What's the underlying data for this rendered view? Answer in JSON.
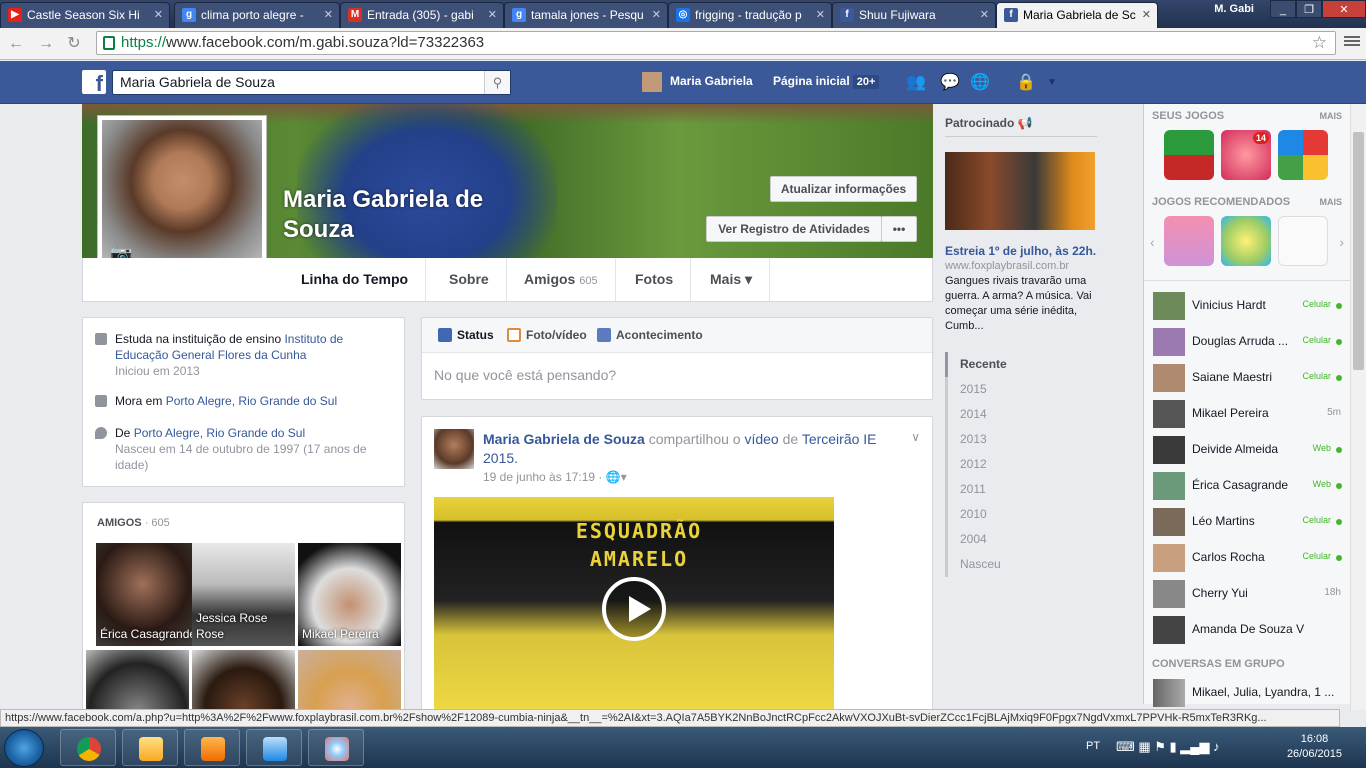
{
  "browser": {
    "tabs": [
      {
        "label": "Castle Season Six Hi",
        "icon": "youtube-icon",
        "color": "#e62117",
        "glyph": "▶"
      },
      {
        "label": "clima porto alegre -",
        "icon": "google-icon",
        "color": "#4285f4",
        "glyph": "g"
      },
      {
        "label": "Entrada (305) - gabi",
        "icon": "gmail-icon",
        "color": "#d93025",
        "glyph": "M"
      },
      {
        "label": "tamala jones - Pesqu",
        "icon": "google-icon",
        "color": "#4285f4",
        "glyph": "g"
      },
      {
        "label": "frigging - tradução p",
        "icon": "translator-icon",
        "color": "#1a73e8",
        "glyph": "◎"
      },
      {
        "label": "Shuu Fujiwara",
        "icon": "facebook-icon",
        "color": "#3b5998",
        "glyph": "f"
      },
      {
        "label": "Maria Gabriela de Sc",
        "icon": "facebook-icon",
        "color": "#3b5998",
        "glyph": "f"
      }
    ],
    "user": "M. Gabi",
    "url_scheme": "https://",
    "url_rest": "www.facebook.com/m.gabi.souza?ld=73322363",
    "status_url": "https://www.facebook.com/a.php?u=http%3A%2F%2Fwww.foxplaybrasil.com.br%2Fshow%2F12089-cumbia-ninja&__tn__=%2AI&xt=3.AQIa7A5BYK2NnBoJnctRCpFcc2AkwVXOJXuBt-svDierZCcc1FcjBLAjMxiq9F0Fpgx7NgdVxmxL7PPVHk-R5mxTeR3RKg..."
  },
  "fb": {
    "search_value": "Maria Gabriela de Souza",
    "nav_name": "Maria Gabriela",
    "home_label": "Página inicial",
    "home_badge": "20+"
  },
  "profile": {
    "name": "Maria Gabriela de Souza",
    "update_info": "Atualizar informações",
    "activity_log": "Ver Registro de Atividades",
    "more_dots": "•••",
    "tabs": [
      {
        "label": "Linha do Tempo"
      },
      {
        "label": "Sobre"
      },
      {
        "label": "Amigos",
        "count": "605"
      },
      {
        "label": "Fotos"
      },
      {
        "label": "Mais ▾"
      }
    ]
  },
  "intro": {
    "study_prefix": "Estuda na instituição de ensino",
    "study_link": "Instituto de Educação General Flores da Cunha",
    "study_since": "Iniciou em 2013",
    "lives_prefix": "Mora em",
    "lives_link": "Porto Alegre, Rio Grande do Sul",
    "from_prefix": "De",
    "from_link": "Porto Alegre, Rio Grande do Sul",
    "born": "Nasceu em 14 de outubro de 1997 (17 anos de idade)"
  },
  "friends": {
    "title": "AMIGOS",
    "count": "· 605",
    "items": [
      {
        "name": "Érica Casagrande"
      },
      {
        "name": "Jessica Rose Rose"
      },
      {
        "name": "Mikael Pereira"
      },
      {
        "name": ""
      },
      {
        "name": ""
      },
      {
        "name": ""
      }
    ]
  },
  "composer": {
    "status": "Status",
    "photo": "Foto/vídeo",
    "event": "Acontecimento",
    "placeholder": "No que você está pensando?"
  },
  "post": {
    "author": "Maria Gabriela de Souza",
    "shared": "compartilhou o",
    "video_word": "vídeo",
    "of": "de",
    "source": "Terceirão IE 2015.",
    "time": "19 de junho às 17:19 ·",
    "video_text": "ESQUADRÃO AMARELO"
  },
  "ad": {
    "sponsored": "Patrocinado",
    "title": "Estreia 1º de julho, às 22h...",
    "url": "www.foxplaybrasil.com.br",
    "desc": "Gangues rivais travarão uma guerra. A arma? A música. Vai começar uma série inédita, Cumb..."
  },
  "timeline_years": [
    "Recente",
    "2015",
    "2014",
    "2013",
    "2012",
    "2011",
    "2010",
    "2004",
    "Nasceu"
  ],
  "sidebar": {
    "my_games": "SEUS JOGOS",
    "recommended": "JOGOS RECOMENDADOS",
    "more": "MAIS",
    "game_badge": "14",
    "group_chats": "CONVERSAS EM GRUPO",
    "contacts": [
      {
        "name": "Vinicius Hardt",
        "status": "Celular",
        "dot": true
      },
      {
        "name": "Douglas Arruda ...",
        "status": "Celular",
        "dot": true
      },
      {
        "name": "Saiane Maestri",
        "status": "Celular",
        "dot": true
      },
      {
        "name": "Mikael Pereira",
        "status": "5m",
        "dot": false
      },
      {
        "name": "Deivide Almeida",
        "status": "Web",
        "dot": true
      },
      {
        "name": "Érica Casagrande",
        "status": "Web",
        "dot": true
      },
      {
        "name": "Léo Martins",
        "status": "Celular",
        "dot": true
      },
      {
        "name": "Carlos Rocha",
        "status": "Celular",
        "dot": true
      },
      {
        "name": "Cherry Yui",
        "status": "18h",
        "dot": false
      },
      {
        "name": "Amanda De Souza Ventura",
        "status": "",
        "dot": false
      }
    ],
    "group": "Mikael, Julia, Lyandra, 1 ..."
  },
  "taskbar": {
    "lang": "PT",
    "time": "16:08",
    "date": "26/06/2015"
  }
}
